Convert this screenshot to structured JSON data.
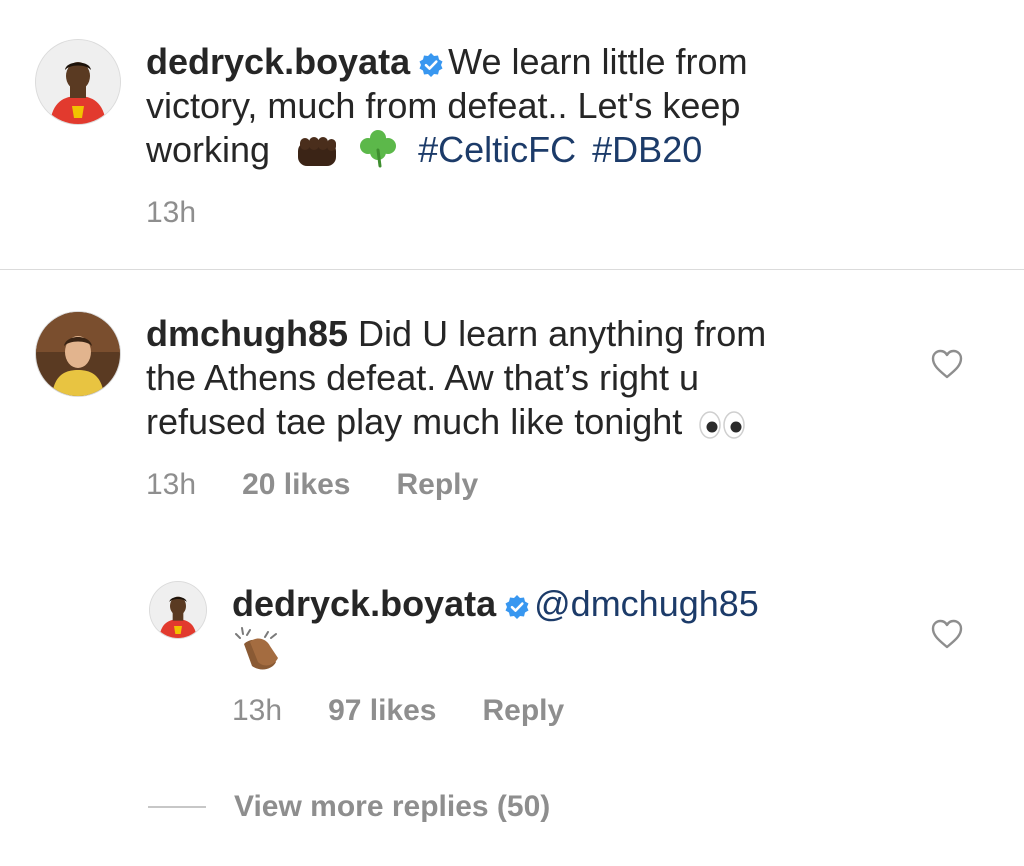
{
  "post": {
    "username": "dedryck.boyata",
    "caption_line1": "We learn little from",
    "caption_line2": "victory, much from defeat.. Let's keep",
    "caption_line3": "working",
    "hashtag1": "#CelticFC",
    "hashtag2": "#DB20",
    "time": "13h"
  },
  "comment": {
    "username": "dmchugh85",
    "text_line1": "Did U learn anything from",
    "text_line2": "the Athens defeat. Aw that’s right u",
    "text_line3": "refused tae play much like tonight",
    "time": "13h",
    "likes": "20 likes",
    "reply_label": "Reply"
  },
  "reply": {
    "username": "dedryck.boyata",
    "mention": "@dmchugh85",
    "time": "13h",
    "likes": "97 likes",
    "reply_label": "Reply"
  },
  "view_more": {
    "label": "View more replies (50)"
  },
  "colors": {
    "verified": "#3897f0",
    "link": "#1c3b69",
    "muted": "#8e8e8e"
  },
  "icons": [
    "verified-badge-icon",
    "fist-emoji-icon",
    "shamrock-emoji-icon",
    "eyes-emoji-icon",
    "clapping-hands-emoji-icon",
    "heart-outline-icon"
  ]
}
